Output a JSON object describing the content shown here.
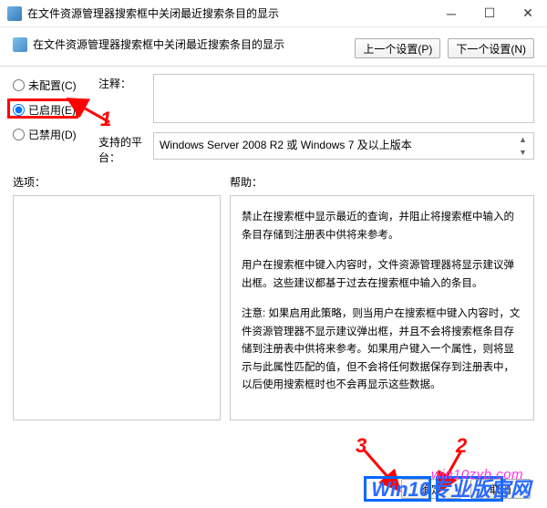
{
  "window": {
    "title": "在文件资源管理器搜索框中关闭最近搜索条目的显示"
  },
  "header": {
    "title": "在文件资源管理器搜索框中关闭最近搜索条目的显示",
    "prev_btn": "上一个设置(P)",
    "next_btn": "下一个设置(N)"
  },
  "radios": {
    "not_configured": "未配置(C)",
    "enabled": "已启用(E)",
    "disabled": "已禁用(D)"
  },
  "fields": {
    "comment_label": "注释：",
    "comment_value": "",
    "supported_label": "支持的平台：",
    "supported_value": "Windows Server 2008 R2 或 Windows 7 及以上版本"
  },
  "lower": {
    "options_label": "选项：",
    "help_label": "帮助：",
    "help_p1": "禁止在搜索框中显示最近的查询，并阻止将搜索框中输入的条目存储到注册表中供将来参考。",
    "help_p2": "用户在搜索框中键入内容时，文件资源管理器将显示建议弹出框。这些建议都基于过去在搜索框中输入的条目。",
    "help_p3": "注意: 如果启用此策略，则当用户在搜索框中键入内容时，文件资源管理器不显示建议弹出框，并且不会将搜索框条目存储到注册表中供将来参考。如果用户键入一个属性，则将显示与此属性匹配的值，但不会将任何数据保存到注册表中，以后使用搜索框时也不会再显示这些数据。"
  },
  "footer": {
    "ok": "确定",
    "cancel": "取消"
  },
  "annotations": {
    "n1": "1",
    "n2": "2",
    "n3": "3",
    "wm1": "win10zyb.com",
    "wm2": "Win10专业版官网"
  }
}
